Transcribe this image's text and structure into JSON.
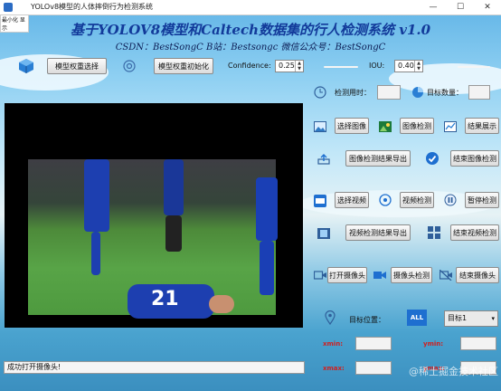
{
  "window": {
    "title": "YOLOv8模型的人体摔倒行为检测系统",
    "side_tag": "最小化 显示",
    "min": "—",
    "max": "☐",
    "close": "✕"
  },
  "header": {
    "title": "基于YOLOV8模型和Caltech数据集的行人检测系统 v1.0",
    "subtitle": "CSDN：BestSongC   B站：Bestsongc   微信公众号：BestSongC"
  },
  "toolbar": {
    "select_weights": "模型权重选择",
    "init_weights": "模型权重初始化",
    "confidence_label": "Confidence:",
    "confidence_value": "0.25",
    "confidence_level": 0.25,
    "iou_label": "IOU:",
    "iou_value": "0.40",
    "iou_level": 0.4
  },
  "stats": {
    "time_label": "检测用时：",
    "time_value": "",
    "count_label": "目标数量：",
    "count_value": ""
  },
  "image_row": {
    "select": "选择图像",
    "detect": "图像检测",
    "show": "结果展示"
  },
  "export_row": {
    "export": "图像检测结果导出",
    "end": "结束图像检测"
  },
  "video_row": {
    "select": "选择视频",
    "detect": "视频检测",
    "pause": "暂停检测"
  },
  "video_export_row": {
    "export": "视频检测结果导出",
    "end": "结束视频检测"
  },
  "camera_row": {
    "open": "打开摄像头",
    "detect": "摄像头检测",
    "end": "结束摄像头"
  },
  "target": {
    "label": "目标位置：",
    "badge": "ALL",
    "selected": "目标1"
  },
  "coords": {
    "xmin_label": "xmin:",
    "ymin_label": "ymin:",
    "xmax_label": "xmax:",
    "ymax_label": "ymax:",
    "xmin": "",
    "ymin": "",
    "xmax": "",
    "ymax": ""
  },
  "status": {
    "text": "成功打开摄像头!"
  },
  "video": {
    "jersey_number": "21"
  },
  "watermark": "@稀土掘金技术社区",
  "colors": {
    "title": "#123a9a",
    "accent_icon": "#1e6fd0"
  }
}
